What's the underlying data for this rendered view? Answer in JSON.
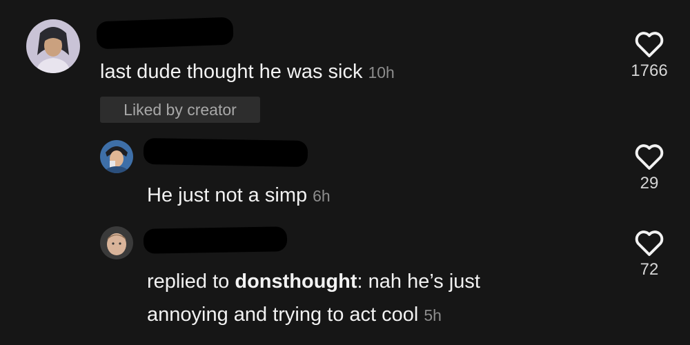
{
  "comments": [
    {
      "text": "last dude thought he was sick",
      "time": "10h",
      "badge": "Liked by creator",
      "likes": "1766"
    },
    {
      "text": "He just not a simp",
      "time": "6h",
      "likes": "29"
    },
    {
      "prefix": "replied to ",
      "mention": "donsthought",
      "line1_rest": ": nah he’s just",
      "line2": "annoying and trying to act cool",
      "time": "5h",
      "likes": "72"
    }
  ],
  "icons": {
    "like": "heart-outline-icon"
  },
  "colors": {
    "background": "#161616",
    "text": "#f2f2f2",
    "muted": "#8d8d8d",
    "badge_bg": "#2d2d2d"
  }
}
